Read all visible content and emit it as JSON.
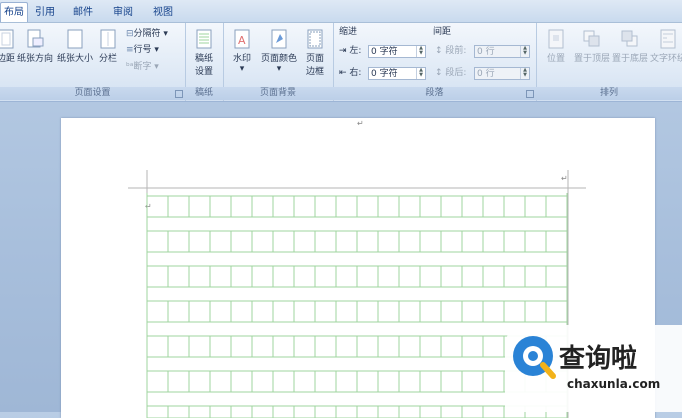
{
  "tabs": [
    {
      "label": "布局",
      "active": true
    },
    {
      "label": "引用",
      "active": false
    },
    {
      "label": "邮件",
      "active": false
    },
    {
      "label": "审阅",
      "active": false
    },
    {
      "label": "视图",
      "active": false
    }
  ],
  "page_setup": {
    "margins": "边距",
    "orientation": "纸张方向",
    "size": "纸张大小",
    "columns": "分栏",
    "breaks": "分隔符",
    "line_numbers": "行号",
    "hyphenation": "断字",
    "group_label": "页面设置"
  },
  "draft_paper": {
    "label1": "稿纸",
    "label2": "设置",
    "group_label": "稿纸"
  },
  "page_background": {
    "watermark": "水印",
    "page_color": "页面颜色",
    "borders1": "页面",
    "borders2": "边框",
    "group_label": "页面背景"
  },
  "paragraph": {
    "indent_title": "缩进",
    "left_label": "左:",
    "left_value": "0 字符",
    "right_label": "右:",
    "right_value": "0 字符",
    "spacing_title": "间距",
    "before_label": "段前:",
    "before_value": "0 行",
    "after_label": "段后:",
    "after_value": "0 行",
    "group_label": "段落"
  },
  "arrange": {
    "position": "位置",
    "bring_front": "置于顶层",
    "send_back": "置于底层",
    "text_wrap": "文字环绕",
    "group_label": "排列"
  },
  "document": {
    "para_mark": "↵"
  },
  "watermark": {
    "brand_cn": "查询啦",
    "brand_url": "chaxunla.com"
  },
  "colors": {
    "grid": "#9fd49f",
    "accent": "#15428b"
  }
}
